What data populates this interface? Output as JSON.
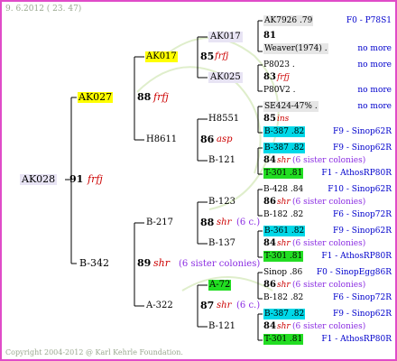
{
  "header": {
    "date": "9. 6.2012 ( 23. 47)"
  },
  "footer": {
    "copyright": "Copyright 2004-2012 @ Karl Kehrle Foundation."
  },
  "tree": {
    "root": {
      "id": "AK028",
      "num": "91",
      "tag": "frfj"
    },
    "g1a": {
      "id": "AK027",
      "num": "88",
      "tag": "frfj"
    },
    "g1b": {
      "id": "B-342",
      "num": "89",
      "tag": "shr",
      "note": "(6 sister colonies)"
    },
    "g2a": {
      "id": "AK017",
      "num": "85",
      "tag": "frfj"
    },
    "g2b": {
      "id": "H8611",
      "num": "86",
      "tag": "asp"
    },
    "g2c": {
      "id": "B-217",
      "num": "88",
      "tag": "shr",
      "note": "(6 c.)"
    },
    "g2d": {
      "id": "A-322",
      "num": "87",
      "tag": "shr",
      "note": "(6 c.)"
    },
    "g3": [
      {
        "id": "AK017"
      },
      {
        "id": "AK025"
      },
      {
        "id": "H8551"
      },
      {
        "id": "B-121"
      },
      {
        "id": "B-123"
      },
      {
        "id": "B-137"
      },
      {
        "id": "A-72"
      },
      {
        "id": "B-121"
      }
    ],
    "g4": [
      {
        "id": "AK7926 .79",
        "src": "F0 - P78S1"
      },
      {
        "num": "81"
      },
      {
        "id": "Weaver(1974) .",
        "src": "no more"
      },
      {
        "id": "P8023 .",
        "src": "no more"
      },
      {
        "num": "83",
        "tag": "frfj"
      },
      {
        "id": "P80V2 .",
        "src": "no more"
      },
      {
        "id": "SE424-47% .",
        "src": "no more"
      },
      {
        "num": "85",
        "tag": "ins"
      },
      {
        "id": "B-387 .82",
        "src": "F9 - Sinop62R"
      },
      {
        "id": "B-387 .82",
        "src": "F9 - Sinop62R"
      },
      {
        "num": "84",
        "tag": "shr",
        "note": "(6 sister colonies)"
      },
      {
        "id": "T-301 .81",
        "src": "F1 - AthosRP80R"
      },
      {
        "id": "B-428 .84",
        "src": "F10 - Sinop62R"
      },
      {
        "num": "86",
        "tag": "shr",
        "note": "(6 sister colonies)"
      },
      {
        "id": "B-182 .82",
        "src": "F6 - Sinop72R"
      },
      {
        "id": "B-361 .82",
        "src": "F9 - Sinop62R"
      },
      {
        "num": "84",
        "tag": "shr",
        "note": "(6 sister colonies)"
      },
      {
        "id": "T-301 .81",
        "src": "F1 - AthosRP80R"
      },
      {
        "id": "Sinop .86",
        "src": "F0 - SinopEgg86R"
      },
      {
        "num": "86",
        "tag": "shr",
        "note": "(6 sister colonies)"
      },
      {
        "id": "B-182 .82",
        "src": "F6 - Sinop72R"
      },
      {
        "id": "B-387 .82",
        "src": "F9 - Sinop62R"
      },
      {
        "num": "84",
        "tag": "shr",
        "note": "(6 sister colonies)"
      },
      {
        "id": "T-301 .81",
        "src": "F1 - AthosRP80R"
      }
    ]
  },
  "colors": {
    "frame": "#e04cc8",
    "highlight_yellow": "#ffff00",
    "highlight_cyan": "#00d8e8",
    "highlight_green": "#22dd22",
    "tag_red": "#cc0000",
    "note_purple": "#8a2be2",
    "source_blue": "#0000cc"
  }
}
